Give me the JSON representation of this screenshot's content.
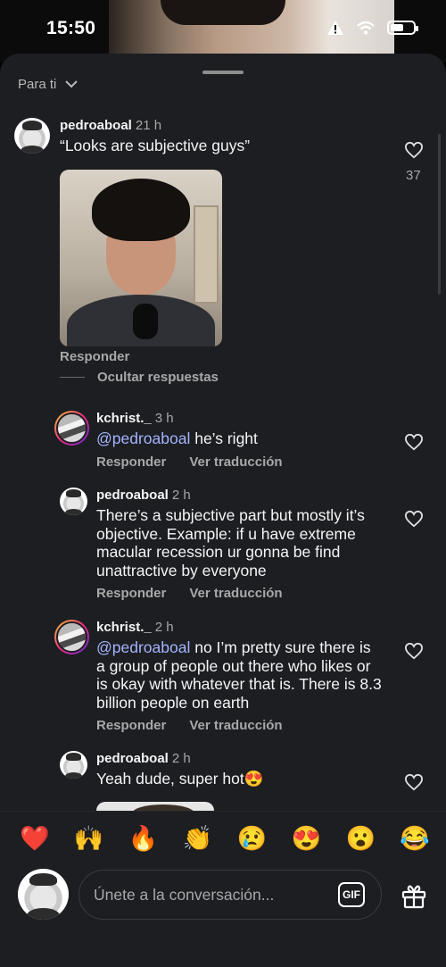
{
  "status": {
    "time": "15:50"
  },
  "sheet": {
    "sort_label": "Para ti"
  },
  "comments": [
    {
      "user": "pedroaboal",
      "time": "21 h",
      "text": "“Looks are subjective guys”",
      "likes": "37",
      "reply_label": "Responder",
      "hide_replies": "Ocultar respuestas"
    },
    {
      "user": "kchrist._",
      "time": "3 h",
      "mention": "@pedroaboal",
      "text": " he’s right",
      "reply_label": "Responder",
      "translate_label": "Ver traducción"
    },
    {
      "user": "pedroaboal",
      "time": "2 h",
      "text": "There’s a subjective part but mostly it’s objective. Example: if u have extreme macular recession ur gonna be find unattractive by everyone",
      "reply_label": "Responder",
      "translate_label": "Ver traducción"
    },
    {
      "user": "kchrist._",
      "time": "2 h",
      "mention": "@pedroaboal",
      "text": " no I’m pretty sure there is a group of people out there who likes or is okay with whatever that is. There is 8.3 billion people on earth",
      "reply_label": "Responder",
      "translate_label": "Ver traducción"
    },
    {
      "user": "pedroaboal",
      "time": "2 h",
      "text": "Yeah dude, super hot😍"
    }
  ],
  "emoji_bar": [
    "❤️",
    "🙌",
    "🔥",
    "👏",
    "😢",
    "😍",
    "😮",
    "😂"
  ],
  "composer": {
    "placeholder": "Únete a la conversación...",
    "gif_label": "GIF"
  }
}
